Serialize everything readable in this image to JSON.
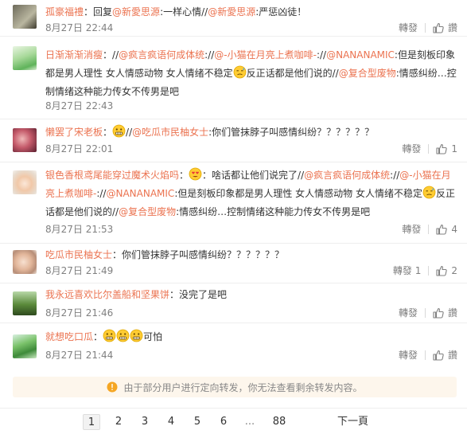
{
  "comments": [
    {
      "user": "孤豪福禮",
      "separator": "：",
      "text_before": "回复",
      "mentions": [
        "@新愛思源",
        "@新愛思源"
      ],
      "text_mid1": ":一样心情//",
      "text_end": ":严惩凶徒！",
      "date": "8月27日 22:44",
      "repost": "轉發",
      "like": "讚",
      "like_count": ""
    },
    {
      "user": "日渐渐渐消瘦",
      "separator": "：",
      "segments": [
        {
          "type": "text",
          "value": "//"
        },
        {
          "type": "mention",
          "value": "@疯言疯语何成体统"
        },
        {
          "type": "text",
          "value": ":"
        },
        {
          "type": "text",
          "value": "//"
        },
        {
          "type": "mention",
          "value": "@-小猫在月亮上煮咖啡-"
        },
        {
          "type": "text",
          "value": "://"
        },
        {
          "type": "mention",
          "value": "@NANANAMIC"
        },
        {
          "type": "text",
          "value": ":但是刻板印象都是男人理性 女人情感动物 女人情绪不稳定"
        },
        {
          "type": "emoji",
          "value": "sweat-emoji"
        },
        {
          "type": "text",
          "value": "反正话都是他们说的//"
        },
        {
          "type": "mention",
          "value": "@复合型废物"
        },
        {
          "type": "text",
          "value": ":情感纠纷…控制情绪这种能力传女不传男是吧"
        }
      ],
      "date": "8月27日 22:43",
      "repost": "",
      "like": "",
      "like_count": ""
    },
    {
      "user": "懒罢了宋老板",
      "separator": "：",
      "segments": [
        {
          "type": "emoji",
          "value": "grimace-emoji"
        },
        {
          "type": "text",
          "value": "//"
        },
        {
          "type": "mention",
          "value": "@吃瓜市民柚女士"
        },
        {
          "type": "text",
          "value": ":你们管抹脖子叫感情纠纷？？？？？？"
        }
      ],
      "date": "8月27日 22:01",
      "repost": "轉發",
      "like": "",
      "like_count": "1"
    },
    {
      "user": "银色香根鸢尾能穿过魔术火焰吗",
      "separator": "：",
      "segments": [
        {
          "type": "emoji",
          "value": "heart-eyes-emoji"
        },
        {
          "type": "text",
          "value": "：啥话都让他们说完了//"
        },
        {
          "type": "mention",
          "value": "@疯言疯语何成体统"
        },
        {
          "type": "text",
          "value": ":"
        },
        {
          "type": "text",
          "value": "//"
        },
        {
          "type": "mention",
          "value": "@-小猫在月亮上煮咖啡-"
        },
        {
          "type": "text",
          "value": "://"
        },
        {
          "type": "mention",
          "value": "@NANANAMIC"
        },
        {
          "type": "text",
          "value": ":但是刻板印象都是男人理性 女人情感动物 女人情绪不稳定"
        },
        {
          "type": "emoji",
          "value": "sweat-emoji"
        },
        {
          "type": "text",
          "value": "反正话都是他们说的//"
        },
        {
          "type": "mention",
          "value": "@复合型废物"
        },
        {
          "type": "text",
          "value": ":情感纠纷…控制情绪这种能力传女不传男是吧"
        }
      ],
      "date": "8月27日 21:53",
      "repost": "轉發",
      "like": "",
      "like_count": "4"
    },
    {
      "user": "吃瓜市民柚女士",
      "separator": "：",
      "segments": [
        {
          "type": "text",
          "value": "你们管抹脖子叫感情纠纷？？？？？？"
        }
      ],
      "date": "8月27日 21:49",
      "repost": "轉發 1",
      "like": "",
      "like_count": "2"
    },
    {
      "user": "我永远喜欢比尔盖船和坚果饼",
      "separator": "：",
      "segments": [
        {
          "type": "text",
          "value": "没完了是吧"
        }
      ],
      "date": "8月27日 21:46",
      "repost": "轉發",
      "like": "讚",
      "like_count": ""
    },
    {
      "user": "就想吃口瓜",
      "separator": "：",
      "segments": [
        {
          "type": "emoji",
          "value": "grimace-emoji"
        },
        {
          "type": "emoji",
          "value": "grimace-emoji"
        },
        {
          "type": "emoji",
          "value": "grimace-emoji"
        },
        {
          "type": "text",
          "value": "可怕"
        }
      ],
      "date": "8月27日 21:44",
      "repost": "轉發",
      "like": "讚",
      "like_count": ""
    }
  ],
  "notice": {
    "icon": "info-icon",
    "text": "由于部分用户进行定向转发，你无法查看剩余转发内容。"
  },
  "pagination": {
    "pages": [
      "1",
      "2",
      "3",
      "4",
      "5",
      "6",
      "...",
      "88"
    ],
    "current": "1",
    "next": "下一頁"
  },
  "colors": {
    "link": "#eb7350",
    "meta": "#808080",
    "notice_bg": "#fdf6ec"
  }
}
